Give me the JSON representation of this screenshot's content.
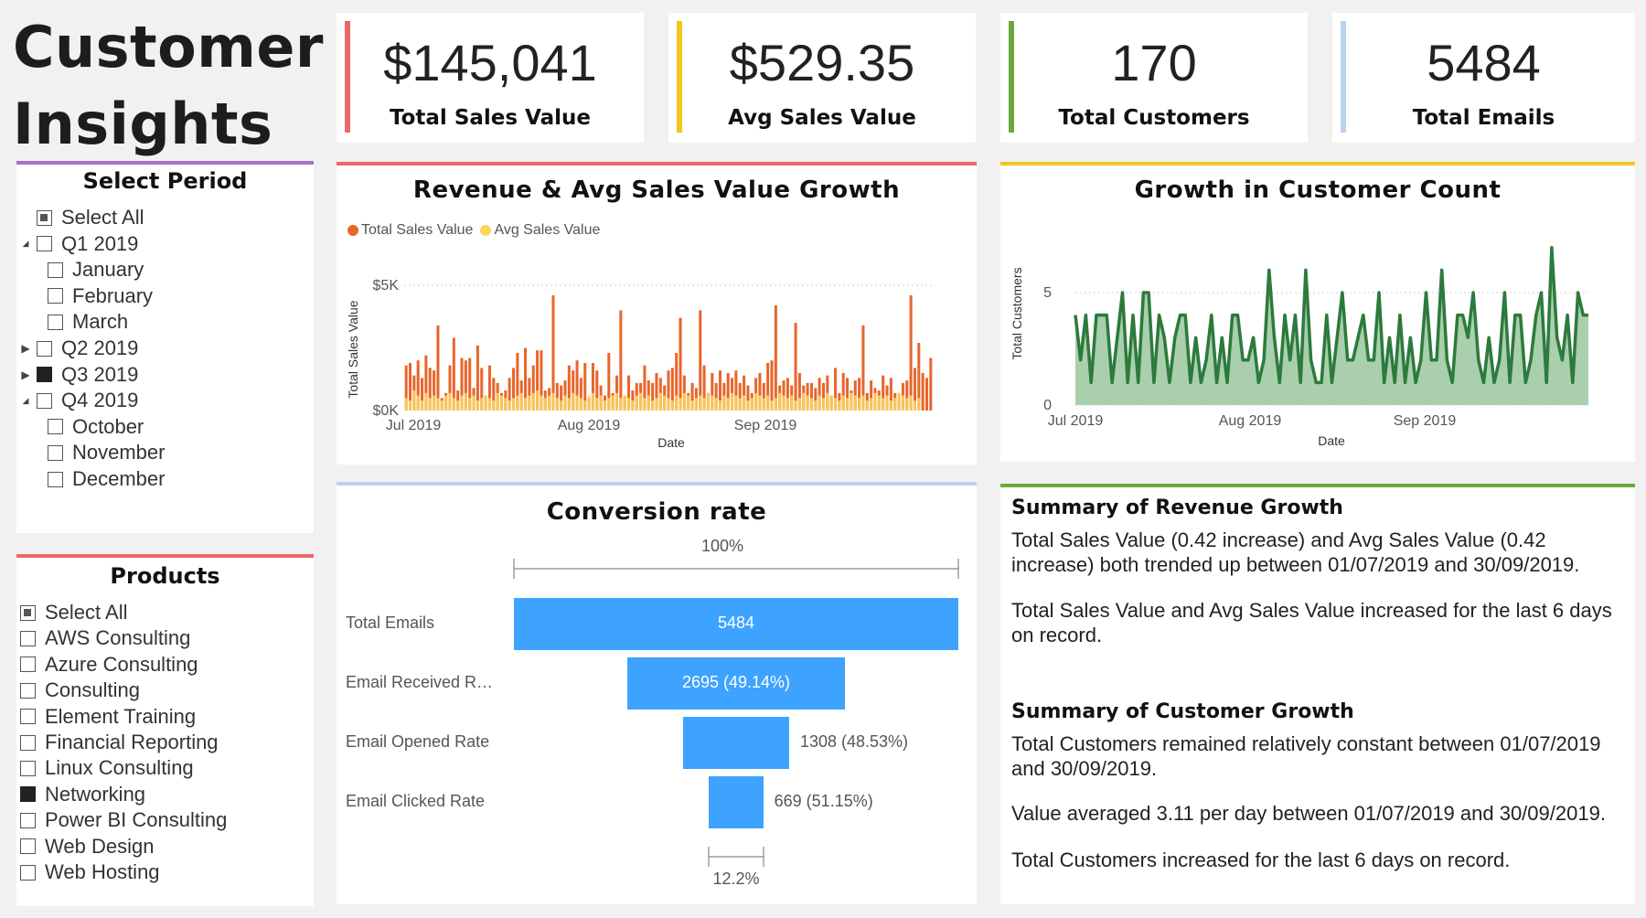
{
  "title": "Customer Insights",
  "colors": {
    "accent_red": "#e8696c",
    "accent_yellow": "#f4c51f",
    "accent_green": "#6aaa3a",
    "accent_blue": "#b9d3ec",
    "accent_purple": "#a970c9",
    "bar_orange": "#e8662c",
    "bar_yellow": "#fbd55f",
    "line_green": "#2d7a3d",
    "area_green": "#a9cfac",
    "funnel_blue": "#3ea3ff"
  },
  "kpis": [
    {
      "value": "$145,041",
      "label": "Total Sales Value"
    },
    {
      "value": "$529.35",
      "label": "Avg Sales Value"
    },
    {
      "value": "170",
      "label": "Total Customers"
    },
    {
      "value": "5484",
      "label": "Total Emails"
    }
  ],
  "period_slicer": {
    "title": "Select Period",
    "items": [
      {
        "label": "Select All",
        "state": "partial",
        "level": 0,
        "caret": ""
      },
      {
        "label": "Q1 2019",
        "state": "empty",
        "level": 0,
        "caret": "expanded"
      },
      {
        "label": "January",
        "state": "empty",
        "level": 1,
        "caret": ""
      },
      {
        "label": "February",
        "state": "empty",
        "level": 1,
        "caret": ""
      },
      {
        "label": "March",
        "state": "empty",
        "level": 1,
        "caret": ""
      },
      {
        "label": "Q2 2019",
        "state": "empty",
        "level": 0,
        "caret": "collapsed"
      },
      {
        "label": "Q3 2019",
        "state": "filled",
        "level": 0,
        "caret": "collapsed"
      },
      {
        "label": "Q4 2019",
        "state": "empty",
        "level": 0,
        "caret": "expanded"
      },
      {
        "label": "October",
        "state": "empty",
        "level": 1,
        "caret": ""
      },
      {
        "label": "November",
        "state": "empty",
        "level": 1,
        "caret": ""
      },
      {
        "label": "December",
        "state": "empty",
        "level": 1,
        "caret": ""
      }
    ]
  },
  "products_slicer": {
    "title": "Products",
    "items": [
      {
        "label": "Select All",
        "state": "partial"
      },
      {
        "label": "AWS Consulting",
        "state": "empty"
      },
      {
        "label": "Azure Consulting",
        "state": "empty"
      },
      {
        "label": "Consulting",
        "state": "empty"
      },
      {
        "label": "Element Training",
        "state": "empty"
      },
      {
        "label": "Financial Reporting",
        "state": "empty"
      },
      {
        "label": "Linux Consulting",
        "state": "empty"
      },
      {
        "label": "Networking",
        "state": "filled"
      },
      {
        "label": "Power BI Consulting",
        "state": "empty"
      },
      {
        "label": "Web Design",
        "state": "empty"
      },
      {
        "label": "Web Hosting",
        "state": "empty"
      }
    ]
  },
  "revenue_chart": {
    "title": "Revenue & Avg Sales Value Growth",
    "legend": [
      "Total Sales Value",
      "Avg Sales Value"
    ],
    "ylabel": "Total Sales Value",
    "xlabel": "Date",
    "yticks": [
      "$5K",
      "$0K"
    ],
    "xticks": [
      "Jul 2019",
      "Aug 2019",
      "Sep 2019"
    ]
  },
  "customer_chart": {
    "title": "Growth in Customer Count",
    "ylabel": "Total Customers",
    "xlabel": "Date",
    "yticks": [
      "5",
      "0"
    ],
    "xticks": [
      "Jul 2019",
      "Aug 2019",
      "Sep 2019"
    ]
  },
  "chart_data": [
    {
      "type": "bar",
      "title": "Revenue & Avg Sales Value Growth",
      "xlabel": "Date",
      "ylabel": "Total Sales Value",
      "ylim": [
        0,
        5500
      ],
      "x_range": [
        "2019-07-01",
        "2019-09-30"
      ],
      "series": [
        {
          "name": "Total Sales Value",
          "values": [
            1800,
            1900,
            1400,
            2000,
            1300,
            2200,
            1700,
            1600,
            3400,
            500,
            700,
            1800,
            2900,
            800,
            2100,
            2000,
            2100,
            900,
            2600,
            1700,
            600,
            1800,
            1300,
            1100,
            700,
            800,
            1300,
            1700,
            2300,
            1200,
            2500,
            1300,
            1800,
            2400,
            2400,
            800,
            900,
            4600,
            1100,
            1000,
            1200,
            1800,
            1600,
            2000,
            1300,
            1900,
            500,
            1900,
            1600,
            1000,
            600,
            2300,
            700,
            1400,
            4000,
            600,
            1400,
            800,
            1100,
            1100,
            1800,
            1200,
            1100,
            1500,
            1300,
            1000,
            1600,
            1700,
            2300,
            3700,
            1400,
            700,
            1100,
            900,
            4000,
            1800,
            700,
            1500,
            1100,
            1600,
            1100,
            1500,
            1300,
            1600,
            1100,
            1400,
            1000,
            700,
            1300,
            1500,
            1100,
            1900,
            2000,
            4200,
            1000,
            1200,
            1300,
            1000,
            3500,
            1500,
            1000,
            1100,
            1100,
            900,
            1300,
            1100,
            1400,
            600,
            1700,
            700,
            1500,
            1300,
            800,
            1200,
            1300,
            3400,
            700,
            1200,
            900,
            800,
            1400,
            1000,
            1300,
            700,
            700,
            1100,
            1200,
            4600,
            1700,
            2700,
            1500,
            1300,
            2100
          ]
        },
        {
          "name": "Avg Sales Value",
          "values": [
            500,
            400,
            800,
            600,
            400,
            700,
            500,
            600,
            500,
            400,
            600,
            700,
            500,
            400,
            600,
            700,
            500,
            600,
            400,
            500,
            600,
            500,
            400,
            700,
            600,
            500,
            400,
            500,
            600,
            700,
            500,
            600,
            700,
            800,
            600,
            500,
            600,
            700,
            500,
            400,
            600,
            500,
            700,
            600,
            500,
            400,
            600,
            700,
            500,
            600,
            400,
            500,
            600,
            700,
            500,
            600,
            500,
            400,
            600,
            700,
            500,
            600,
            400,
            500,
            700,
            600,
            500,
            400,
            600,
            500,
            700,
            600,
            400,
            500,
            600,
            500,
            700,
            600,
            500,
            400,
            600,
            500,
            700,
            600,
            500,
            600,
            400,
            500,
            700,
            600,
            500,
            600,
            400,
            500,
            700,
            600,
            500,
            600,
            400,
            500,
            700,
            600,
            500,
            400,
            600,
            500,
            700,
            600,
            500,
            400,
            600,
            500,
            700,
            600,
            500,
            600,
            400,
            500,
            700,
            600,
            500,
            600,
            400,
            500,
            700,
            600,
            500,
            600,
            400,
            500
          ]
        }
      ]
    },
    {
      "type": "area",
      "title": "Growth in Customer Count",
      "xlabel": "Date",
      "ylabel": "Total Customers",
      "ylim": [
        0,
        7
      ],
      "x_range": [
        "2019-07-01",
        "2019-09-30"
      ],
      "series": [
        {
          "name": "Total Customers",
          "values": [
            4,
            2,
            4,
            1,
            4,
            4,
            4,
            1,
            3,
            5,
            1,
            4,
            1,
            5,
            5,
            1,
            4,
            3,
            1,
            3,
            4,
            4,
            1,
            3,
            1,
            2,
            4,
            1,
            3,
            1,
            4,
            4,
            2,
            2,
            3,
            1,
            2,
            6,
            3,
            1,
            4,
            2,
            4,
            1,
            6,
            2,
            1,
            1,
            4,
            1,
            3,
            5,
            2,
            2,
            3,
            4,
            2,
            2,
            5,
            1,
            3,
            1,
            4,
            1,
            3,
            1,
            2,
            5,
            2,
            2,
            6,
            2,
            1,
            4,
            4,
            3,
            5,
            2,
            1,
            3,
            1,
            2,
            5,
            1,
            4,
            4,
            1,
            2,
            4,
            5,
            1,
            7,
            3,
            2,
            4,
            1,
            5,
            4,
            4
          ]
        }
      ]
    },
    {
      "type": "funnel",
      "title": "Conversion rate",
      "categories": [
        "Total Emails",
        "Email Received R…",
        "Email Opened Rate",
        "Email Clicked Rate"
      ],
      "values": [
        5484,
        2695,
        1308,
        669
      ],
      "value_labels": [
        "5484",
        "2695 (49.14%)",
        "1308 (48.53%)",
        "669 (51.15%)"
      ],
      "top_pct": "100%",
      "bottom_pct": "12.2%"
    }
  ],
  "summary": {
    "revenue_title": "Summary of Revenue Growth",
    "revenue_p1": "Total Sales Value (0.42 increase) and Avg Sales Value (0.42 increase) both trended up between 01/07/2019 and 30/09/2019.",
    "revenue_p2": "Total Sales Value and Avg Sales Value increased for the last 6 days on record.",
    "customer_title": "Summary of Customer Growth",
    "customer_p1": "Total Customers remained relatively constant between 01/07/2019 and 30/09/2019.",
    "customer_p2": "Value averaged 3.11 per day between 01/07/2019 and 30/09/2019.",
    "customer_p3": "Total Customers increased for the last 6 days on record."
  }
}
